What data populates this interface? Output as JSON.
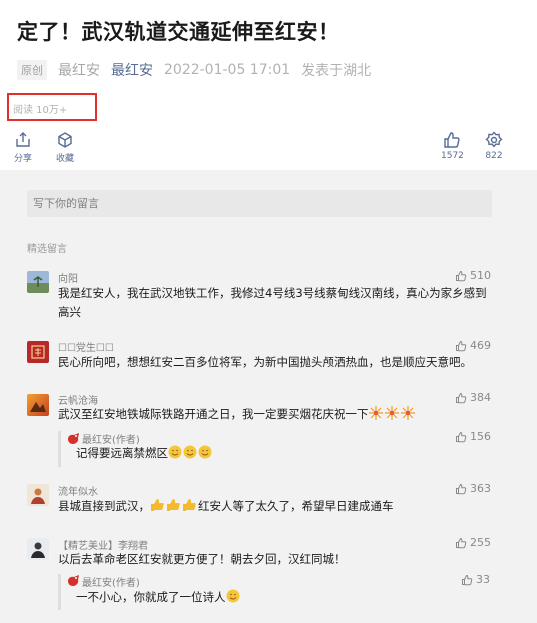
{
  "article": {
    "title": "定了！武汉轨道交通延伸至红安！",
    "original_badge": "原创",
    "author_name": "最红安",
    "account_name": "最红安",
    "date": "2022-01-05 17:01",
    "location": "发表于湖北",
    "reads": "阅读 10万+"
  },
  "actions": {
    "share": "分享",
    "favorite": "收藏",
    "like_count": "1572",
    "wow_count": "822"
  },
  "comments_section": {
    "input_placeholder": "写下你的留言",
    "label": "精选留言"
  },
  "comments": [
    {
      "name": "向阳",
      "text": "我是红安人，我在武汉地铁工作，我修过4号线3号线蔡甸线汉南线，真心为家乡感到高兴",
      "likes": "510"
    },
    {
      "name": "☐☐党生☐☐",
      "text": "民心所向吧，想想红安二百多位将军，为新中国抛头颅洒热血，也是顺应天意吧。",
      "likes": "469"
    },
    {
      "name": "云帆沧海",
      "text": "武汉至红安地铁城际铁路开通之日，我一定要买烟花庆祝一下",
      "likes": "384",
      "reply": {
        "name": "最红安(作者)",
        "text": "记得要远离禁燃区",
        "likes": "156"
      }
    },
    {
      "name": "流年似水",
      "text_before": "县城直接到武汉，",
      "text_after": "红安人等了太久了，希望早日建成通车",
      "likes": "363"
    },
    {
      "name": "【精艺美业】李翔君",
      "text": "以后去革命老区红安就更方便了！朝去夕回，汉红同城！",
      "likes": "255",
      "reply": {
        "name": "最红安(作者)",
        "text": "一不小心，你就成了一位诗人",
        "likes": "33"
      }
    }
  ],
  "colors": {
    "link_blue": "#576b95",
    "highlight_red": "#e0302b",
    "section_gray": "#f2f2f2"
  },
  "icons": [
    "share-icon",
    "favorite-icon",
    "like-icon",
    "wow-icon",
    "thumb-up-icon"
  ]
}
